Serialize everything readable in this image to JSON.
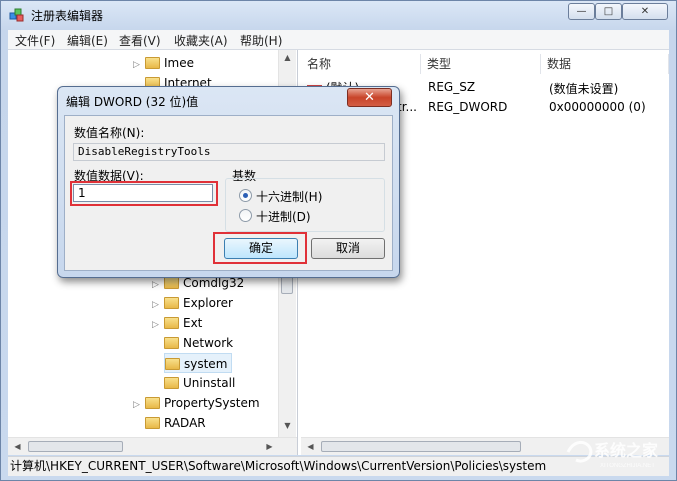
{
  "window": {
    "title": "注册表编辑器",
    "buttons": {
      "minimize": "—",
      "maximize": "□",
      "close": "✕"
    }
  },
  "menu": [
    "文件(F)",
    "编辑(E)",
    "查看(V)",
    "收藏夹(A)",
    "帮助(H)"
  ],
  "tree": {
    "items": [
      {
        "label": "Imee",
        "level": 1,
        "expandable": true
      },
      {
        "label": "Internet",
        "level": 1,
        "expandable": false
      },
      {
        "label": "Comdlg32",
        "level": 2,
        "expandable": true
      },
      {
        "label": "Explorer",
        "level": 2,
        "expandable": true
      },
      {
        "label": "Ext",
        "level": 2,
        "expandable": true
      },
      {
        "label": "Network",
        "level": 2,
        "expandable": false
      },
      {
        "label": "system",
        "level": 2,
        "expandable": false,
        "selected": true
      },
      {
        "label": "Uninstall",
        "level": 2,
        "expandable": false
      },
      {
        "label": "PropertySystem",
        "level": 1,
        "expandable": true
      },
      {
        "label": "RADAR",
        "level": 1,
        "expandable": false
      }
    ]
  },
  "list": {
    "columns": [
      "名称",
      "类型",
      "数据"
    ],
    "rows": [
      {
        "name": "(默认)",
        "type": "REG_SZ",
        "data": "(数值未设置)"
      },
      {
        "name": "tr...",
        "type": "REG_DWORD",
        "data": "0x00000000 (0)"
      }
    ]
  },
  "status_path": "计算机\\HKEY_CURRENT_USER\\Software\\Microsoft\\Windows\\CurrentVersion\\Policies\\system",
  "dialog": {
    "title": "编辑 DWORD (32 位)值",
    "close_label": "✕",
    "name_label": "数值名称(N):",
    "name_value": "DisableRegistryTools",
    "data_label": "数值数据(V):",
    "data_value": "1",
    "base_label": "基数",
    "radio_hex": "十六进制(H)",
    "radio_dec": "十进制(D)",
    "selected_base": "hex",
    "ok": "确定",
    "cancel": "取消"
  },
  "watermark": {
    "text": "系统之家",
    "subtext": "XITONGZHIJIA.NET"
  },
  "colors": {
    "highlight": "#e03138",
    "selection": "#e5f1fb",
    "accent": "#3c7fb1"
  }
}
